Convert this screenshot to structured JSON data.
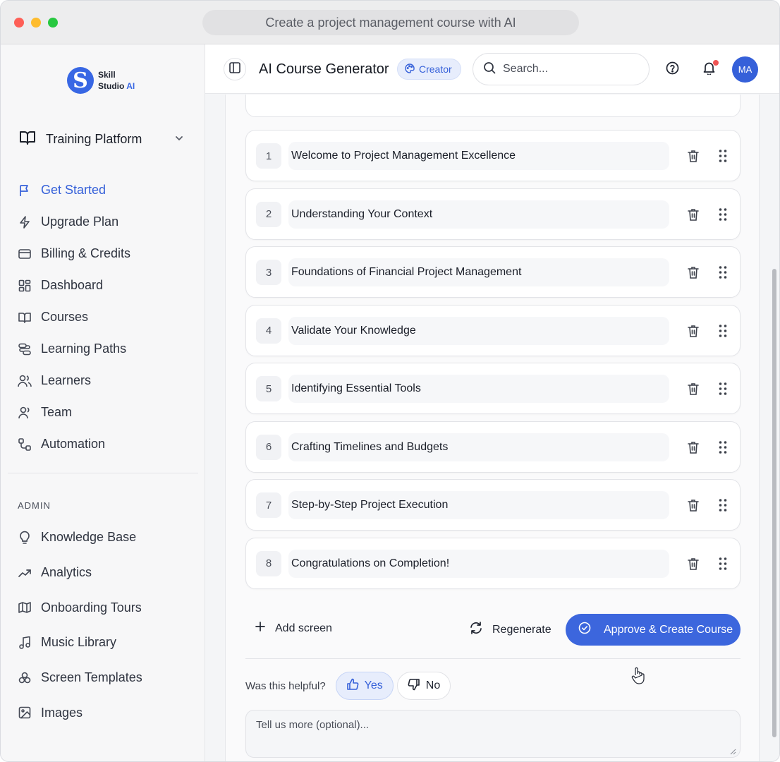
{
  "window": {
    "url_title": "Create a project management course with AI"
  },
  "sidebar": {
    "logo": {
      "mark": "S",
      "line1": "Skill",
      "line2": "Studio",
      "line2_accent": "AI"
    },
    "workspace": "Training Platform",
    "nav": [
      {
        "label": "Get Started",
        "icon": "flag-icon",
        "active": true
      },
      {
        "label": "Upgrade Plan",
        "icon": "lightning-icon"
      },
      {
        "label": "Billing & Credits",
        "icon": "credit-card-icon"
      },
      {
        "label": "Dashboard",
        "icon": "dashboard-icon"
      },
      {
        "label": "Courses",
        "icon": "book-icon"
      },
      {
        "label": "Learning Paths",
        "icon": "route-icon"
      },
      {
        "label": "Learners",
        "icon": "users-icon"
      },
      {
        "label": "Team",
        "icon": "team-icon"
      },
      {
        "label": "Automation",
        "icon": "workflow-icon"
      }
    ],
    "admin_label": "ADMIN",
    "admin_nav": [
      {
        "label": "Knowledge Base",
        "icon": "lightbulb-icon"
      },
      {
        "label": "Analytics",
        "icon": "trending-up-icon"
      },
      {
        "label": "Onboarding Tours",
        "icon": "map-icon"
      },
      {
        "label": "Music Library",
        "icon": "music-icon"
      },
      {
        "label": "Screen Templates",
        "icon": "templates-icon"
      },
      {
        "label": "Images",
        "icon": "image-icon"
      }
    ]
  },
  "header": {
    "title": "AI Course Generator",
    "badge": "Creator",
    "search_placeholder": "Search...",
    "avatar_initials": "MA",
    "accent": "#3560d9"
  },
  "screens": [
    {
      "num": "1",
      "title": "Welcome to Project Management Excellence"
    },
    {
      "num": "2",
      "title": "Understanding Your Context"
    },
    {
      "num": "3",
      "title": "Foundations of Financial Project Management"
    },
    {
      "num": "4",
      "title": "Validate Your Knowledge"
    },
    {
      "num": "5",
      "title": "Identifying Essential Tools"
    },
    {
      "num": "6",
      "title": "Crafting Timelines and Budgets"
    },
    {
      "num": "7",
      "title": "Step-by-Step Project Execution"
    },
    {
      "num": "8",
      "title": "Congratulations on Completion!"
    }
  ],
  "actions": {
    "add_screen": "Add screen",
    "regenerate": "Regenerate",
    "approve": "Approve & Create Course"
  },
  "feedback": {
    "question": "Was this helpful?",
    "yes": "Yes",
    "no": "No",
    "more_placeholder": "Tell us more (optional)..."
  }
}
